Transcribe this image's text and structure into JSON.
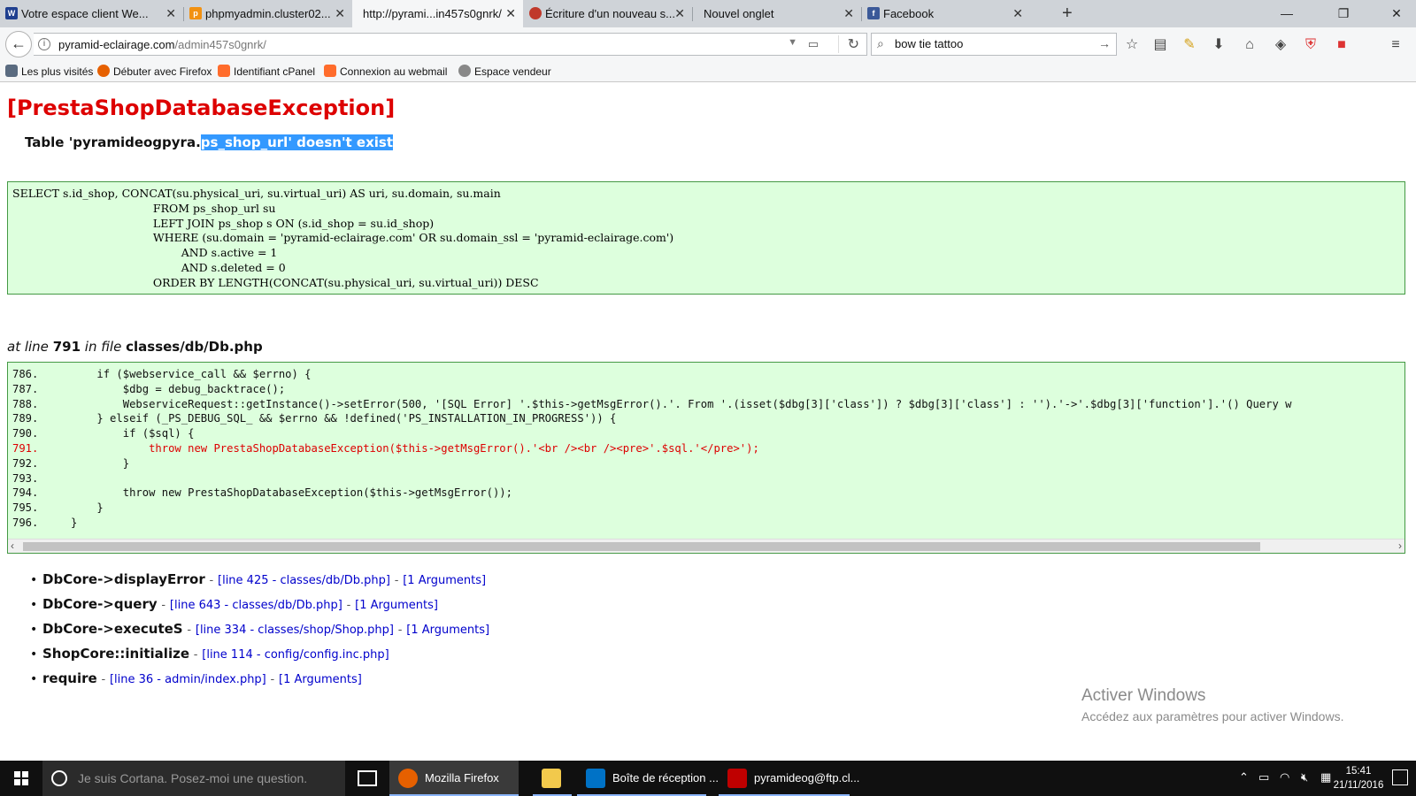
{
  "browser": {
    "tabs": [
      {
        "title": "Votre espace client We...",
        "icon": "ovh-icon",
        "color": "#1f3f8f"
      },
      {
        "title": "phpmyadmin.cluster02...",
        "icon": "phpmyadmin-icon",
        "color": "#f29111"
      },
      {
        "title": "http://pyrami...in457s0gnrk/",
        "icon": "",
        "color": ""
      },
      {
        "title": "Écriture d'un nouveau s...",
        "icon": "forum-icon",
        "color": "#c0392b"
      },
      {
        "title": "Nouvel onglet",
        "icon": "",
        "color": ""
      },
      {
        "title": "Facebook",
        "icon": "facebook-icon",
        "color": "#3b5998"
      }
    ],
    "url_host": "pyramid-eclairage.com",
    "url_path": "/admin457s0gnrk/",
    "search_value": "bow tie tattoo",
    "bookmarks": [
      {
        "label": "Les plus visités",
        "icon": "most-visited-icon"
      },
      {
        "label": "Débuter avec Firefox",
        "icon": "firefox-icon"
      },
      {
        "label": "Identifiant cPanel",
        "icon": "cpanel-icon"
      },
      {
        "label": "Connexion au webmail",
        "icon": "cpanel-icon"
      },
      {
        "label": "Espace vendeur",
        "icon": "seller-icon"
      }
    ]
  },
  "error": {
    "title": "[PrestaShopDatabaseException]",
    "message_prefix": "Table 'pyramideogpyra.",
    "message_selected": "ps_shop_url' doesn't exist",
    "sql": "SELECT s.id_shop, CONCAT(su.physical_uri, su.virtual_uri) AS uri, su.domain, su.main\n                                        FROM ps_shop_url su\n                                        LEFT JOIN ps_shop s ON (s.id_shop = su.id_shop)\n                                        WHERE (su.domain = 'pyramid-eclairage.com' OR su.domain_ssl = 'pyramid-eclairage.com')\n                                                AND s.active = 1\n                                                AND s.deleted = 0\n                                        ORDER BY LENGTH(CONCAT(su.physical_uri, su.virtual_uri)) DESC",
    "at_line_label": "at line",
    "line_number": "791",
    "in_file_label": "in file",
    "file": "classes/db/Db.php",
    "code_lines": [
      {
        "text": "786.         if ($webservice_call && $errno) {",
        "highlight": false
      },
      {
        "text": "787.             $dbg = debug_backtrace();",
        "highlight": false
      },
      {
        "text": "788.             WebserviceRequest::getInstance()->setError(500, '[SQL Error] '.$this->getMsgError().'. From '.(isset($dbg[3]['class']) ? $dbg[3]['class'] : '').'->'.$dbg[3]['function'].'() Query w",
        "highlight": false
      },
      {
        "text": "789.         } elseif (_PS_DEBUG_SQL_ && $errno && !defined('PS_INSTALLATION_IN_PROGRESS')) {",
        "highlight": false
      },
      {
        "text": "790.             if ($sql) {",
        "highlight": false
      },
      {
        "text": "791.                 throw new PrestaShopDatabaseException($this->getMsgError().'<br /><br /><pre>'.$sql.'</pre>');",
        "highlight": true
      },
      {
        "text": "792.             }",
        "highlight": false
      },
      {
        "text": "793.",
        "highlight": false
      },
      {
        "text": "794.             throw new PrestaShopDatabaseException($this->getMsgError());",
        "highlight": false
      },
      {
        "text": "795.         }",
        "highlight": false
      },
      {
        "text": "796.     }",
        "highlight": false
      }
    ],
    "trace": [
      {
        "fn": "DbCore->displayError",
        "line": "[line 425 - classes/db/Db.php]",
        "args": "[1 Arguments]"
      },
      {
        "fn": "DbCore->query",
        "line": "[line 643 - classes/db/Db.php]",
        "args": "[1 Arguments]"
      },
      {
        "fn": "DbCore->executeS",
        "line": "[line 334 - classes/shop/Shop.php]",
        "args": "[1 Arguments]"
      },
      {
        "fn": "ShopCore::initialize",
        "line": "[line 114 - config/config.inc.php]",
        "args": ""
      },
      {
        "fn": "require",
        "line": "[line 36 - admin/index.php]",
        "args": "[1 Arguments]"
      }
    ]
  },
  "watermark": {
    "title": "Activer Windows",
    "subtitle": "Accédez aux paramètres pour activer Windows."
  },
  "taskbar": {
    "cortana_placeholder": "Je suis Cortana. Posez-moi une question.",
    "apps": [
      {
        "label": "Mozilla Firefox",
        "icon": "firefox-icon",
        "color": "#e66000",
        "active": true
      },
      {
        "label": "",
        "icon": "file-explorer-icon",
        "color": "#f2c94c",
        "active": false
      },
      {
        "label": "Boîte de réception ...",
        "icon": "outlook-icon",
        "color": "#0072c6",
        "active": false
      },
      {
        "label": "pyramideog@ftp.cl...",
        "icon": "filezilla-icon",
        "color": "#bf0000",
        "active": false
      }
    ],
    "time": "15:41",
    "date": "21/11/2016"
  }
}
